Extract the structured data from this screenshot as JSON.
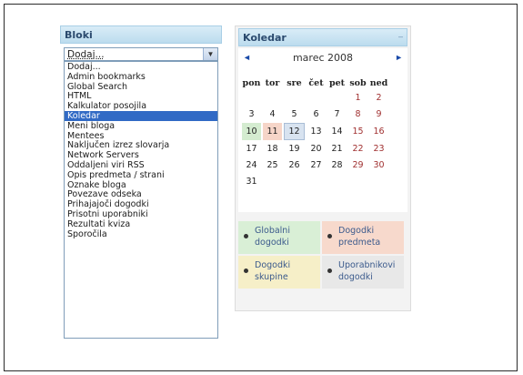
{
  "blocks_panel": {
    "title": "Bloki",
    "select": {
      "current_value": "Dodaj...",
      "options": [
        "Dodaj...",
        "Admin bookmarks",
        "Global Search",
        "HTML",
        "Kalkulator posojila",
        "Koledar",
        "Meni bloga",
        "Mentees",
        "Naključen izrez slovarja",
        "Network Servers",
        "Oddaljeni viri RSS",
        "Opis predmeta / strani",
        "Oznake bloga",
        "Povezave odseka",
        "Prihajajoči dogodki",
        "Prisotni uporabniki",
        "Rezultati kviza",
        "Sporočila"
      ],
      "highlighted_option": "Koledar"
    }
  },
  "calendar": {
    "title": "Koledar",
    "month_label": "marec 2008",
    "prev_icon": "◄",
    "next_icon": "►",
    "weekdays": [
      "pon",
      "tor",
      "sre",
      "čet",
      "pet",
      "sob",
      "ned"
    ],
    "weeks": [
      [
        "",
        "",
        "",
        "",
        "",
        "1",
        "2"
      ],
      [
        "3",
        "4",
        "5",
        "6",
        "7",
        "8",
        "9"
      ],
      [
        "10",
        "11",
        "12",
        "13",
        "14",
        "15",
        "16"
      ],
      [
        "17",
        "18",
        "19",
        "20",
        "21",
        "22",
        "23"
      ],
      [
        "24",
        "25",
        "26",
        "27",
        "28",
        "29",
        "30"
      ],
      [
        "31",
        "",
        "",
        "",
        "",
        "",
        ""
      ]
    ],
    "highlights": {
      "global_event_day": "10",
      "course_event_day": "11",
      "today": "12"
    },
    "legend": {
      "global": "Globalni dogodki",
      "course": "Dogodki predmeta",
      "group": "Dogodki skupine",
      "user": "Uporabnikovi dogodki"
    },
    "colors": {
      "global": "#d9efd6",
      "course": "#f7d9cc",
      "group": "#f6efc8",
      "user": "#e8e8e8",
      "header": "#bcdcee"
    }
  }
}
